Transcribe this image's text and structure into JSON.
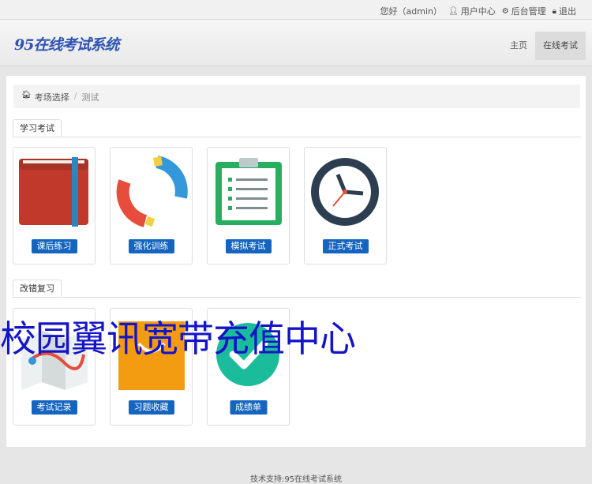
{
  "topbar": {
    "greeting": "您好（admin）",
    "user_center": "用户中心",
    "admin": "后台管理",
    "logout": "退出"
  },
  "header": {
    "logo": "95在线考试系统",
    "nav": [
      "主页",
      "在线考试"
    ]
  },
  "breadcrumb": {
    "home": "考场选择",
    "sep": "/",
    "current": "测试"
  },
  "sections": {
    "study": "学习考试",
    "review": "改错复习"
  },
  "cards": {
    "practice": "课后练习",
    "training": "强化训练",
    "mock": "模拟考试",
    "formal": "正式考试",
    "records": "考试记录",
    "favorites": "习题收藏",
    "scores": "成绩单"
  },
  "watermark": "校园翼讯宽带充值中心",
  "footer": "技术支持:95在线考试系统",
  "colors": {
    "button": "#1565c0",
    "logo": "#2f55b4",
    "watermark": "#1414c8"
  }
}
